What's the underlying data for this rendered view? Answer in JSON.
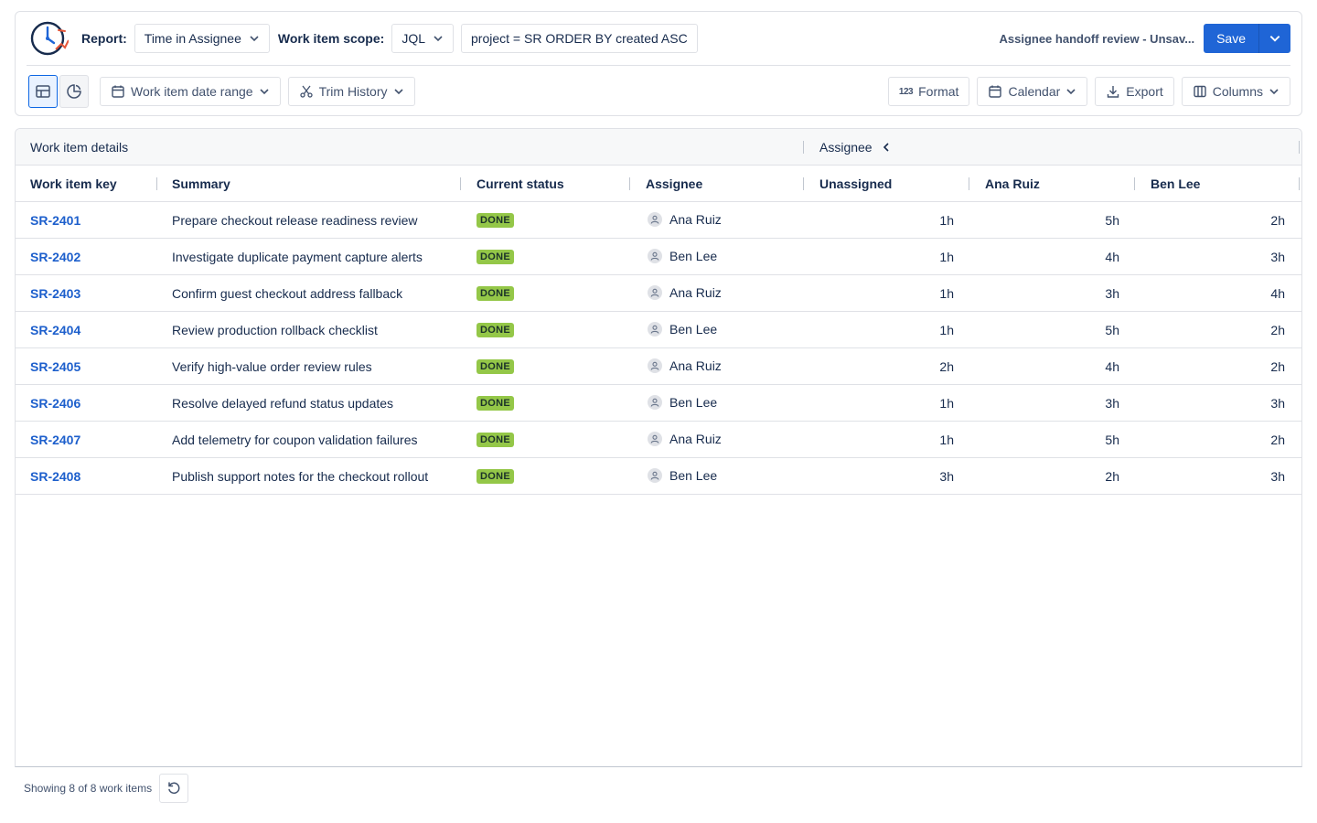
{
  "header": {
    "report_label": "Report:",
    "report_value": "Time in Assignee",
    "scope_label": "Work item scope:",
    "scope_mode": "JQL",
    "jql_query": "project = SR ORDER BY created ASC",
    "report_name": "Assignee handoff review - Unsav...",
    "save_label": "Save",
    "brand_color": "#1f65d6"
  },
  "toolbar": {
    "date_range_label": "Work item date range",
    "trim_history_label": "Trim History",
    "format_label": "Format",
    "calendar_label": "Calendar",
    "export_label": "Export",
    "columns_label": "Columns"
  },
  "table": {
    "group_headers": [
      "Work item details",
      "Assignee"
    ],
    "columns": [
      "Work item key",
      "Summary",
      "Current status",
      "Assignee",
      "Unassigned",
      "Ana Ruiz",
      "Ben Lee"
    ],
    "rows": [
      {
        "key": "SR-2401",
        "summary": "Prepare checkout release readiness review",
        "status": "DONE",
        "assignee": "Ana Ruiz",
        "unassigned": "1h",
        "ana": "5h",
        "ben": "2h"
      },
      {
        "key": "SR-2402",
        "summary": "Investigate duplicate payment capture alerts",
        "status": "DONE",
        "assignee": "Ben Lee",
        "unassigned": "1h",
        "ana": "4h",
        "ben": "3h"
      },
      {
        "key": "SR-2403",
        "summary": "Confirm guest checkout address fallback",
        "status": "DONE",
        "assignee": "Ana Ruiz",
        "unassigned": "1h",
        "ana": "3h",
        "ben": "4h"
      },
      {
        "key": "SR-2404",
        "summary": "Review production rollback checklist",
        "status": "DONE",
        "assignee": "Ben Lee",
        "unassigned": "1h",
        "ana": "5h",
        "ben": "2h"
      },
      {
        "key": "SR-2405",
        "summary": "Verify high-value order review rules",
        "status": "DONE",
        "assignee": "Ana Ruiz",
        "unassigned": "2h",
        "ana": "4h",
        "ben": "2h"
      },
      {
        "key": "SR-2406",
        "summary": "Resolve delayed refund status updates",
        "status": "DONE",
        "assignee": "Ben Lee",
        "unassigned": "1h",
        "ana": "3h",
        "ben": "3h"
      },
      {
        "key": "SR-2407",
        "summary": "Add telemetry for coupon validation failures",
        "status": "DONE",
        "assignee": "Ana Ruiz",
        "unassigned": "1h",
        "ana": "5h",
        "ben": "2h"
      },
      {
        "key": "SR-2408",
        "summary": "Publish support notes for the checkout rollout",
        "status": "DONE",
        "assignee": "Ben Lee",
        "unassigned": "3h",
        "ana": "2h",
        "ben": "3h"
      }
    ]
  },
  "footer": {
    "count_text": "Showing 8 of 8 work items"
  }
}
